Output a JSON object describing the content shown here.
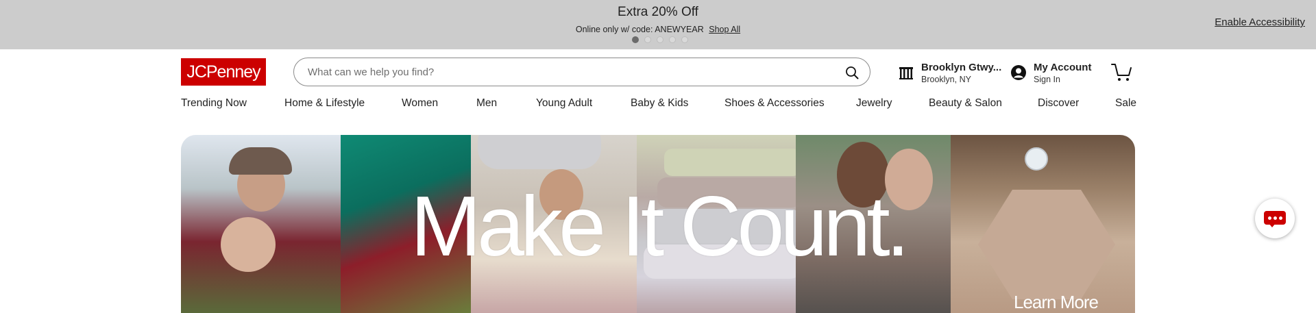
{
  "promo": {
    "title": "Extra 20% Off",
    "subtitle": "Online only w/ code: ANEWYEAR",
    "link": "Shop All",
    "dots_total": 5,
    "dots_active": 1
  },
  "accessibility_link": "Enable Accessibility",
  "header": {
    "logo": "JCPenney",
    "search_placeholder": "What can we help you find?",
    "store_name": "Brooklyn Gtwy...",
    "store_location": "Brooklyn, NY",
    "account_title": "My Account",
    "account_sub": "Sign In"
  },
  "nav": {
    "items": [
      "Trending Now",
      "Home & Lifestyle",
      "Women",
      "Men",
      "Young Adult",
      "Baby & Kids",
      "Shoes & Accessories",
      "Jewelry",
      "Beauty & Salon",
      "Discover",
      "Sale"
    ]
  },
  "hero": {
    "headline": "Make It Count.",
    "cta_partial": "Learn More"
  },
  "icons": {
    "search": "search-icon",
    "store": "store-icon",
    "account": "account-icon",
    "cart": "cart-icon",
    "chat": "chat-icon"
  },
  "colors": {
    "brand": "#cc0000",
    "promo_bg": "#cccccc"
  }
}
